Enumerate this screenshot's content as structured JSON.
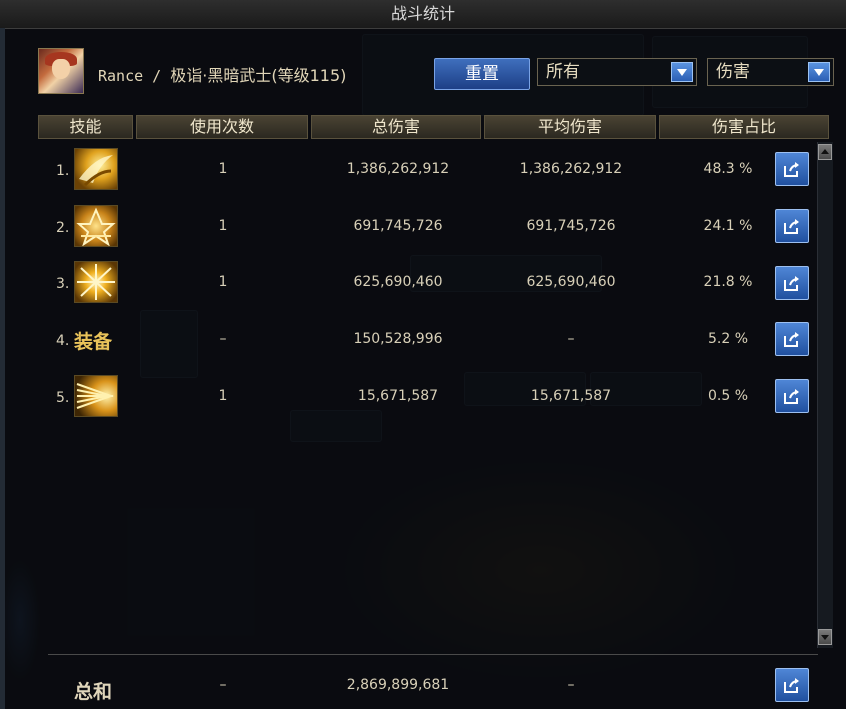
{
  "window": {
    "title": "战斗统计"
  },
  "player": {
    "name": "Rance",
    "separator": " / ",
    "job": "极诣·黑暗武士",
    "level_text": "(等级115)"
  },
  "controls": {
    "reset_label": "重置",
    "filter_select": {
      "value": "所有"
    },
    "type_select": {
      "value": "伤害"
    }
  },
  "table": {
    "columns": [
      "技能",
      "使用次数",
      "总伤害",
      "平均伤害",
      "伤害占比"
    ],
    "rows": [
      {
        "index": "1.",
        "skill_icon": "golden-slash-skill-icon",
        "uses": "1",
        "total": "1,386,262,912",
        "average": "1,386,262,912",
        "share": "48.3 %"
      },
      {
        "index": "2.",
        "skill_icon": "golden-crest-skill-icon",
        "uses": "1",
        "total": "691,745,726",
        "average": "691,745,726",
        "share": "24.1 %"
      },
      {
        "index": "3.",
        "skill_icon": "golden-burst-skill-icon",
        "uses": "1",
        "total": "625,690,460",
        "average": "625,690,460",
        "share": "21.8 %"
      },
      {
        "index": "4.",
        "skill_icon_text": "装备",
        "uses": "–",
        "total": "150,528,996",
        "average": "–",
        "share": "5.2 %"
      },
      {
        "index": "5.",
        "skill_icon": "golden-wave-skill-icon",
        "uses": "1",
        "total": "15,671,587",
        "average": "15,671,587",
        "share": "0.5 %"
      }
    ]
  },
  "summary": {
    "label": "总和",
    "uses": "–",
    "total": "2,869,899,681",
    "average": "–"
  },
  "colors": {
    "accent_blue": "#2b5fb4",
    "header_gold": "#4a4333",
    "text": "#d8d0b8"
  }
}
